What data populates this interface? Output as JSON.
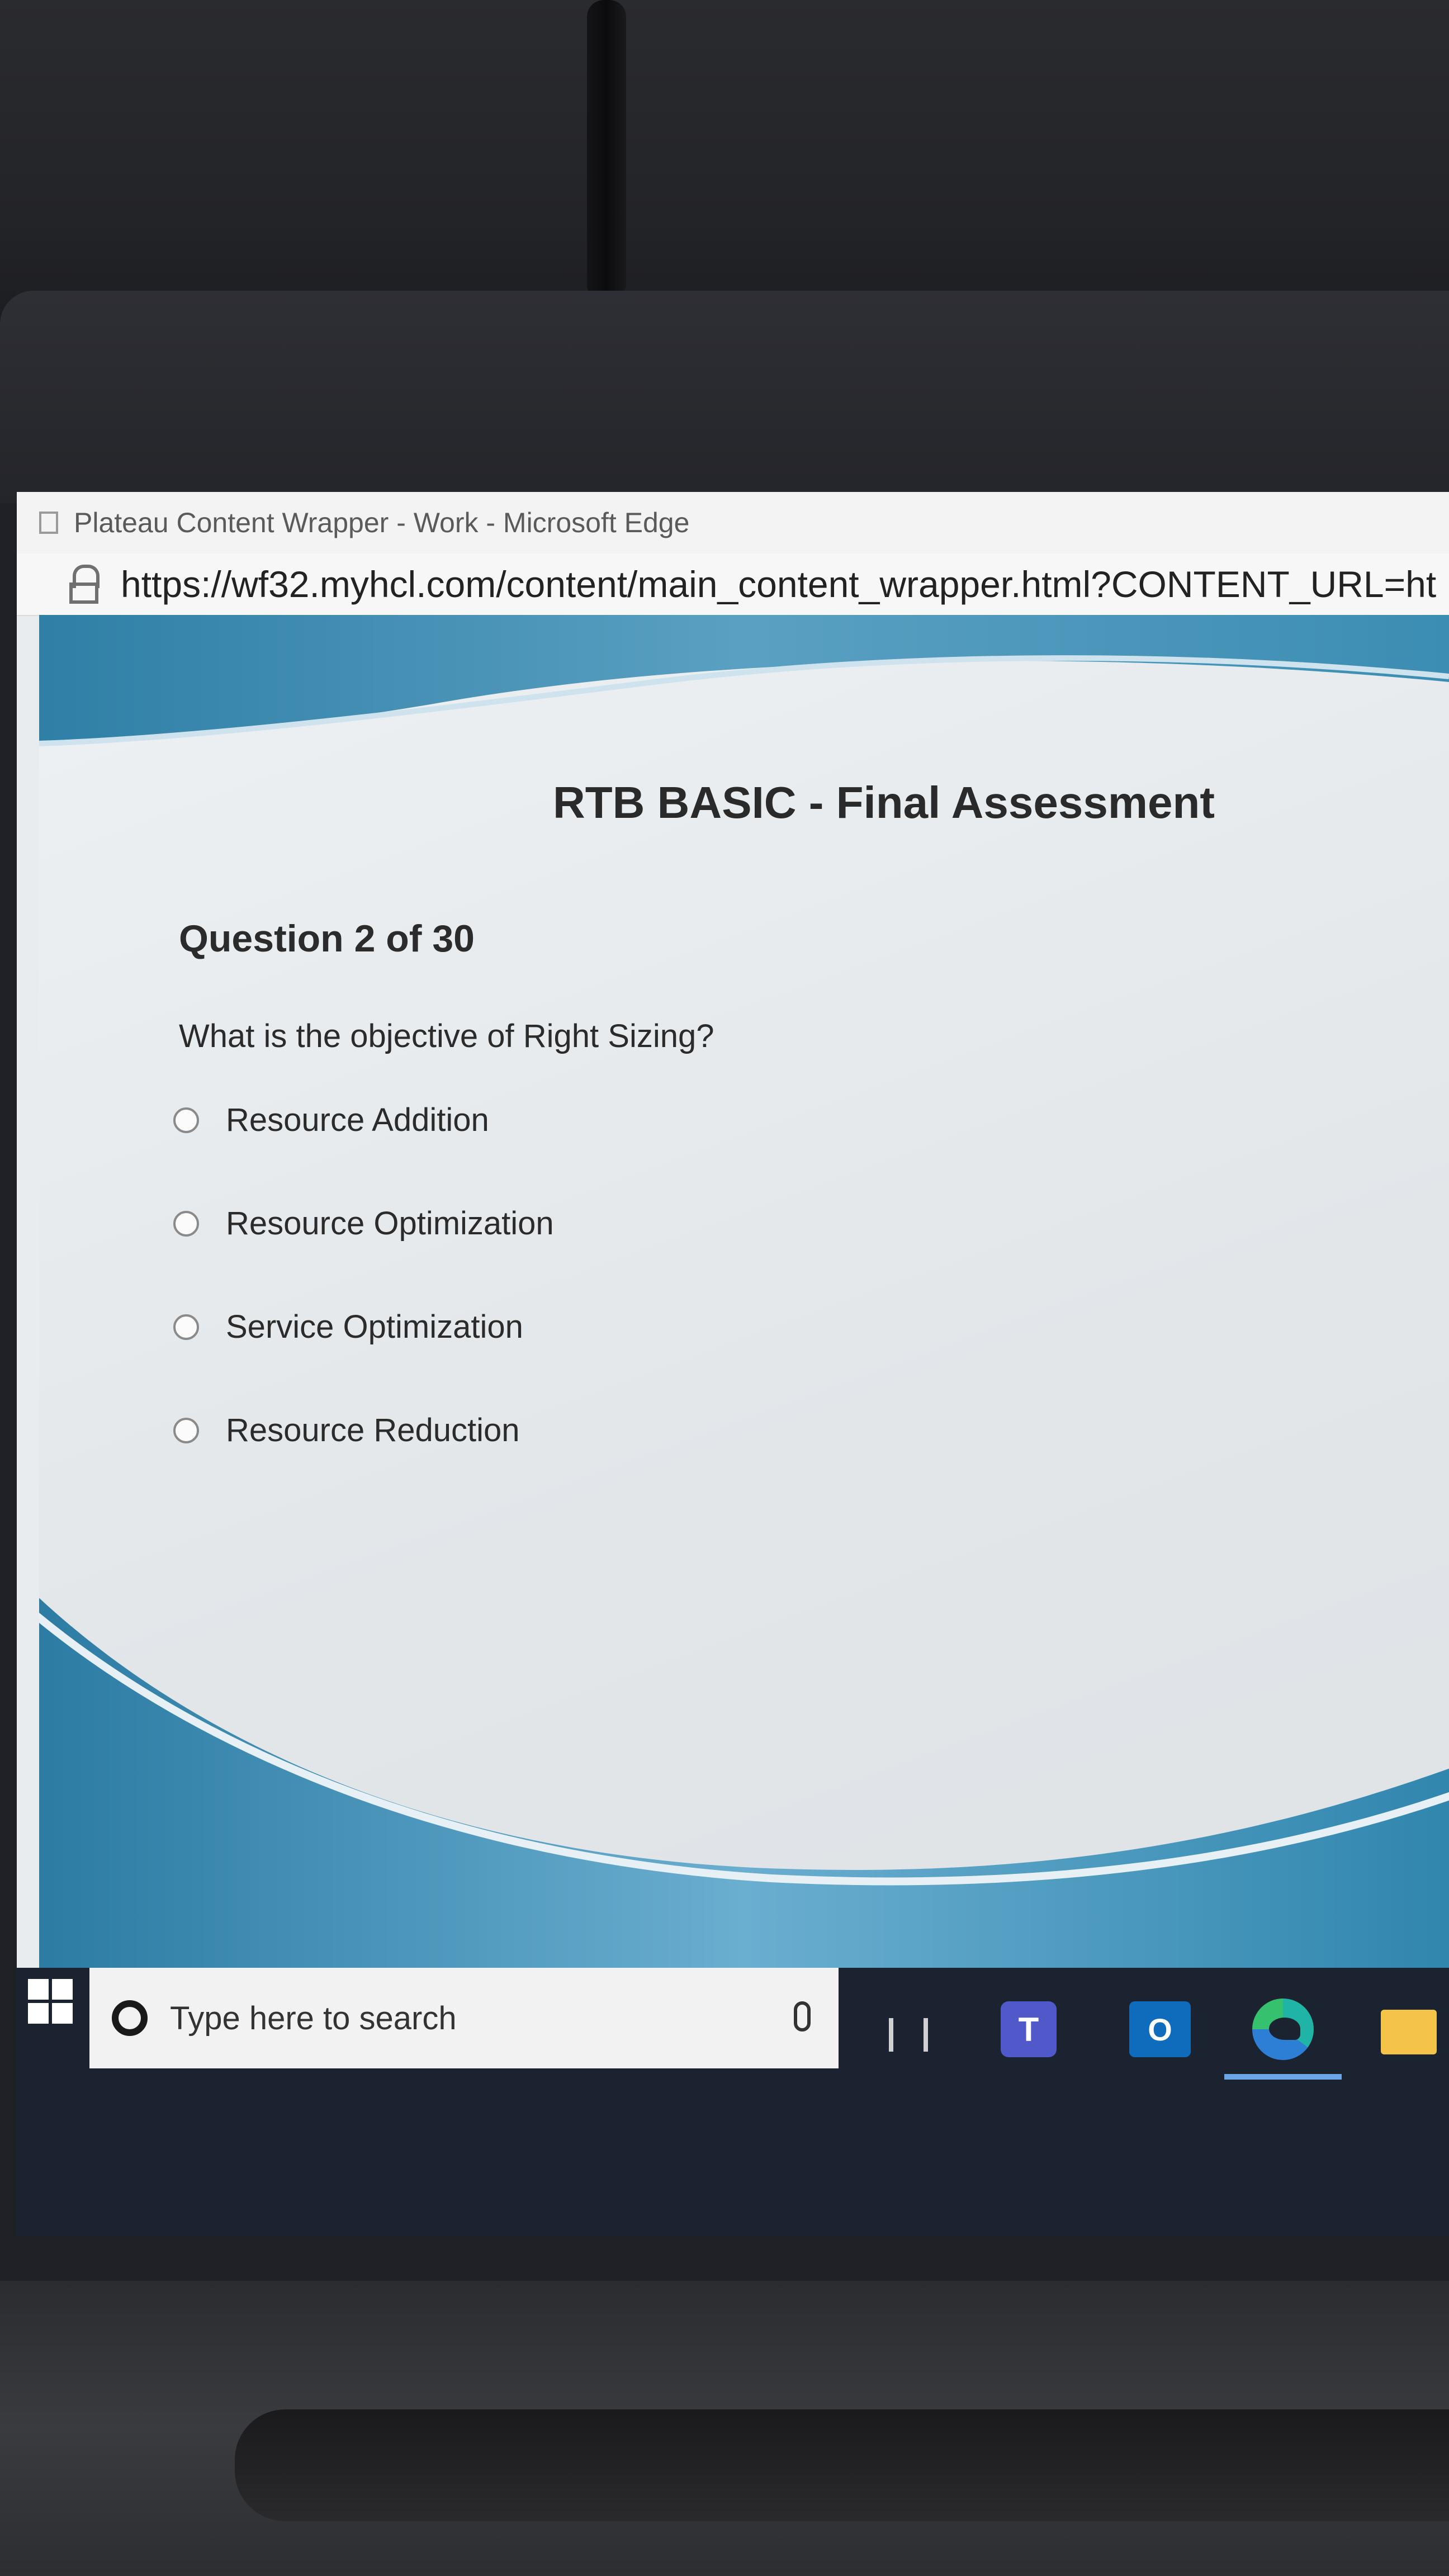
{
  "window": {
    "title": "Plateau Content Wrapper - Work - Microsoft Edge",
    "url": "https://wf32.myhcl.com/content/main_content_wrapper.html?CONTENT_URL=ht"
  },
  "assessment": {
    "title": "RTB BASIC - Final Assessment",
    "question_number": "Question 2 of 30",
    "question_text": "What is the objective of Right Sizing?",
    "options": [
      {
        "label": "Resource Addition"
      },
      {
        "label": "Resource Optimization"
      },
      {
        "label": "Service Optimization"
      },
      {
        "label": "Resource Reduction"
      }
    ]
  },
  "taskbar": {
    "search_placeholder": "Type here to search",
    "apps": [
      "windows-start-icon",
      "task-view-icon",
      "teams-icon",
      "outlook-icon",
      "edge-icon",
      "file-explorer-icon"
    ],
    "teams_glyph": "T",
    "outlook_glyph": "O"
  },
  "colors": {
    "wave_blue": "#2f7fa6",
    "wave_light": "#7fb8d3",
    "taskbar": "#1c2330"
  }
}
